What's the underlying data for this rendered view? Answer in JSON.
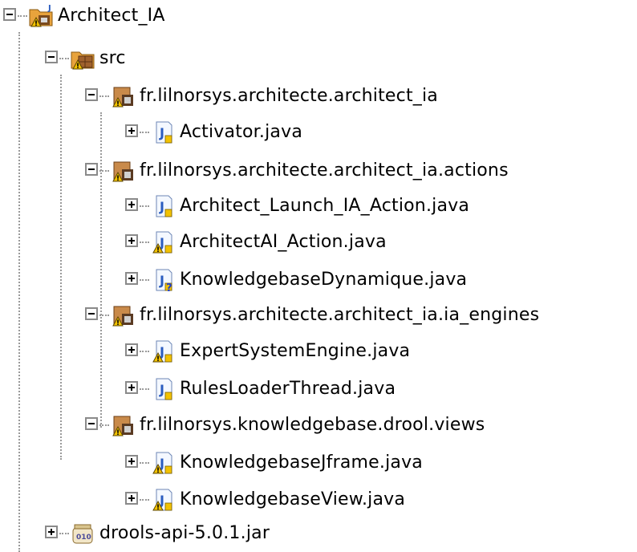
{
  "tree": {
    "nodes": [
      {
        "label": "Architect_IA",
        "icon": "project-folder-icon",
        "level": 0,
        "state": "expanded",
        "badge": "warning"
      },
      {
        "label": "src",
        "icon": "source-folder-icon",
        "level": 1,
        "state": "expanded",
        "badge": "warning"
      },
      {
        "label": "fr.lilnorsys.architecte.architect_ia",
        "icon": "package-icon",
        "level": 2,
        "state": "expanded",
        "badge": "warning"
      },
      {
        "label": "Activator.java",
        "icon": "java-file-icon",
        "level": 3,
        "state": "collapsed",
        "badge": "none"
      },
      {
        "label": "fr.lilnorsys.architecte.architect_ia.actions",
        "icon": "package-icon",
        "level": 2,
        "state": "expanded",
        "badge": "warning"
      },
      {
        "label": "Architect_Launch_IA_Action.java",
        "icon": "java-file-icon",
        "level": 3,
        "state": "collapsed",
        "badge": "none"
      },
      {
        "label": "ArchitectAI_Action.java",
        "icon": "java-file-icon",
        "level": 3,
        "state": "collapsed",
        "badge": "warning"
      },
      {
        "label": "KnowledgebaseDynamique.java",
        "icon": "java-file-unversioned-icon",
        "level": 3,
        "state": "collapsed",
        "badge": "question"
      },
      {
        "label": "fr.lilnorsys.architecte.architect_ia.ia_engines",
        "icon": "package-icon",
        "level": 2,
        "state": "expanded",
        "badge": "warning"
      },
      {
        "label": "ExpertSystemEngine.java",
        "icon": "java-file-icon",
        "level": 3,
        "state": "collapsed",
        "badge": "warning"
      },
      {
        "label": "RulesLoaderThread.java",
        "icon": "java-file-icon",
        "level": 3,
        "state": "collapsed",
        "badge": "none"
      },
      {
        "label": "fr.lilnorsys.knowledgebase.drool.views",
        "icon": "package-unversioned-icon",
        "level": 2,
        "state": "expanded",
        "badge": "warning"
      },
      {
        "label": "KnowledgebaseJframe.java",
        "icon": "java-file-unversioned-icon",
        "level": 3,
        "state": "collapsed",
        "badge": "warning"
      },
      {
        "label": "KnowledgebaseView.java",
        "icon": "java-file-unversioned-icon",
        "level": 3,
        "state": "collapsed",
        "badge": "warning"
      },
      {
        "label": "drools-api-5.0.1.jar",
        "icon": "jar-icon",
        "level": 1,
        "state": "collapsed",
        "badge": "none"
      }
    ]
  },
  "colors": {
    "tree_line": "#9a9a9a",
    "warning_badge": "#f2c200",
    "package_brown": "#a0622d",
    "java_blue": "#2a5cbf",
    "question_blue": "#1f3fd1"
  }
}
